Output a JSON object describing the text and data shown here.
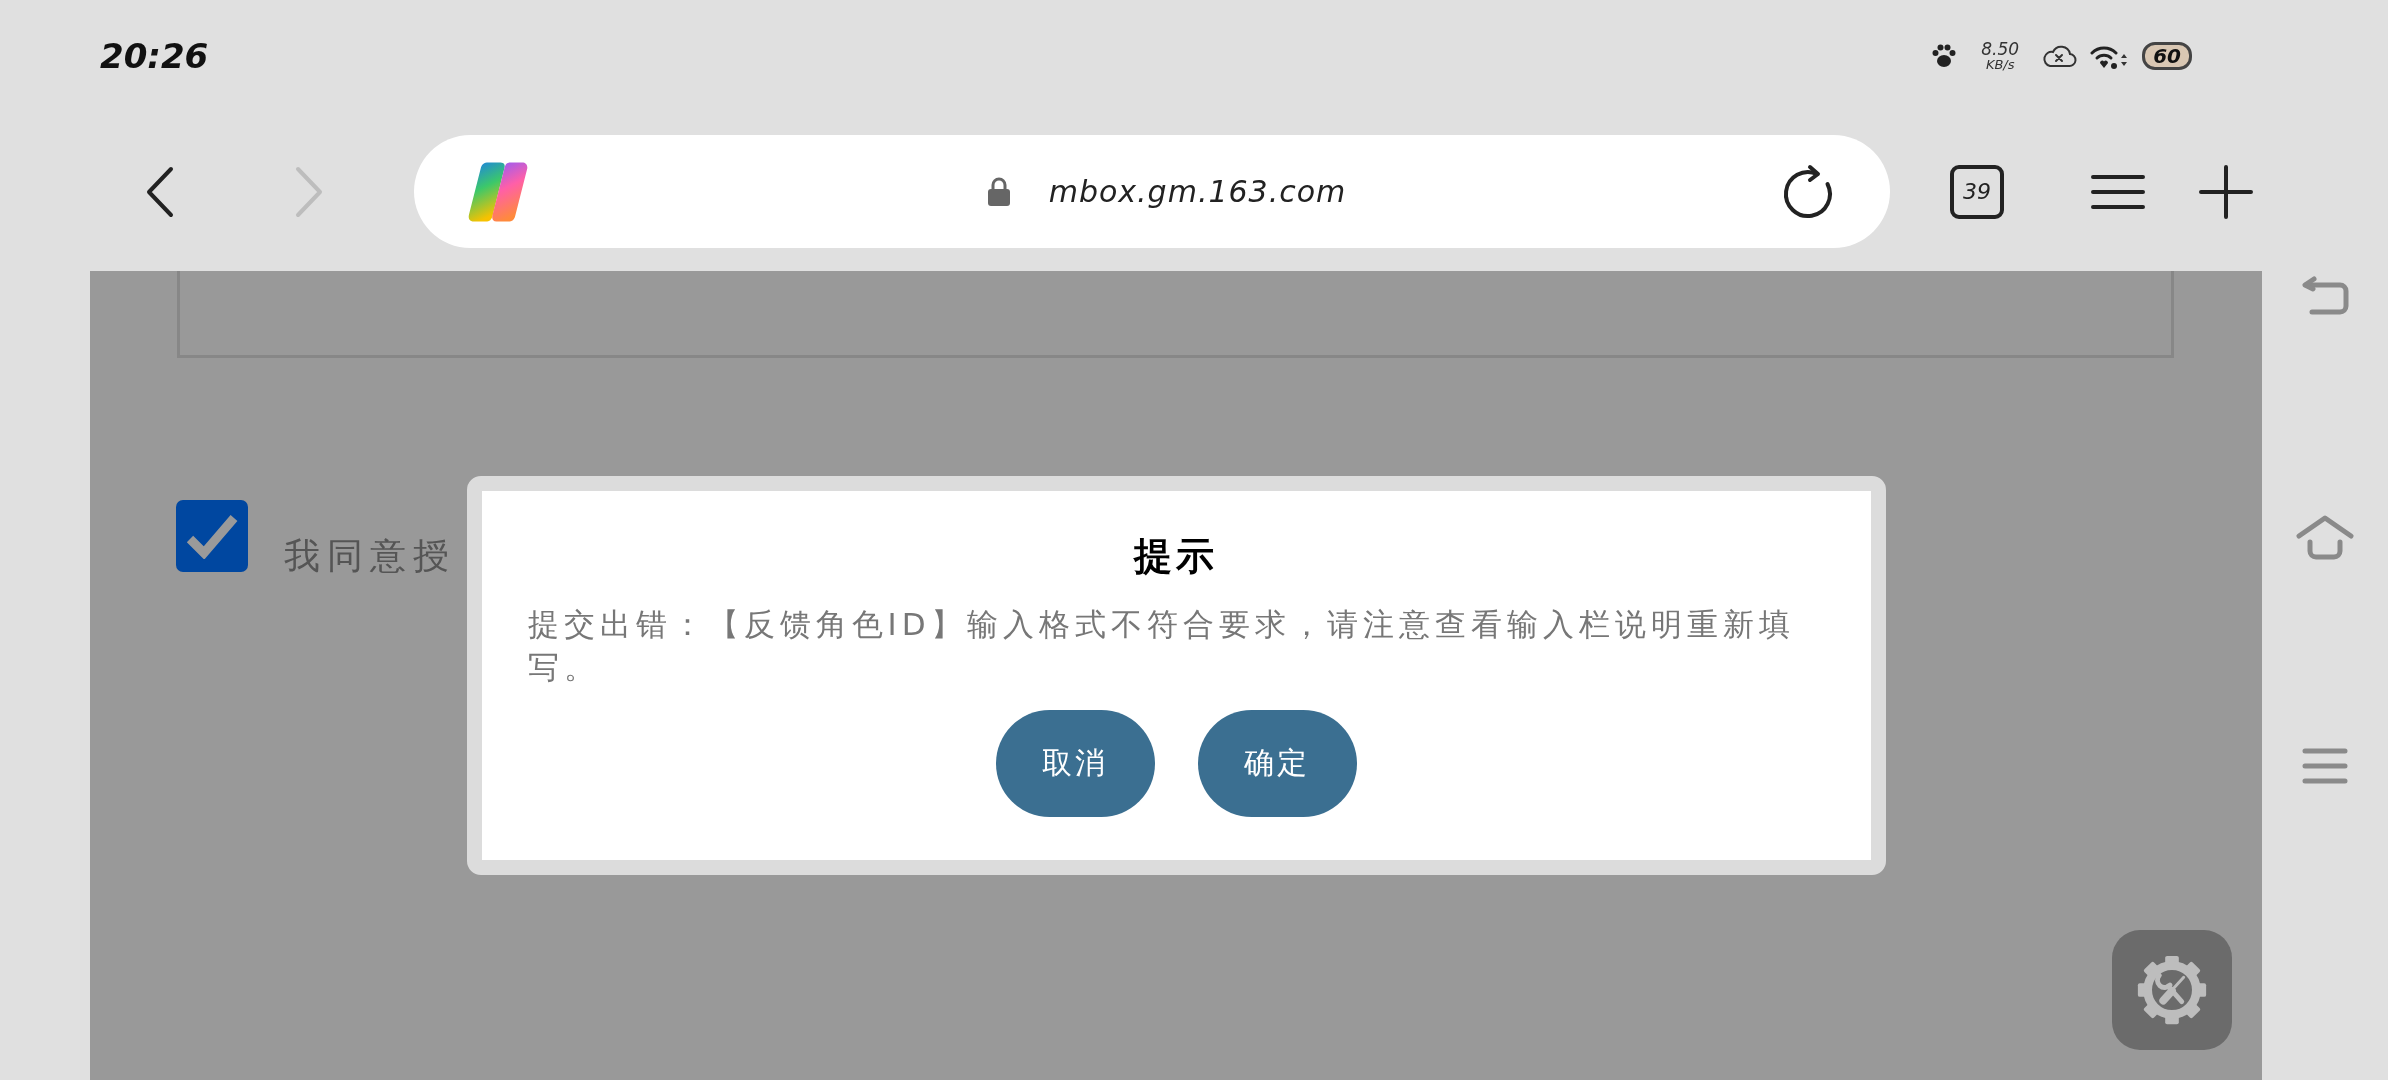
{
  "status_bar": {
    "time": "20:26",
    "network_speed": "8.50",
    "network_speed_unit": "KB/s",
    "battery": "60"
  },
  "browser_toolbar": {
    "navigation": [
      {
        "kind": "back",
        "disabled": false
      },
      {
        "kind": "forward",
        "disabled": true
      }
    ],
    "url": "mbox.gm.163.com",
    "tab_count": "39"
  },
  "page": {
    "agreement": {
      "label": "我同意授",
      "checked": true
    }
  },
  "dialog": {
    "title": "提示",
    "message": "提交出错：【反馈角色ID】输入格式不符合要求，请注意查看输入栏说明重新填写。",
    "buttons": [
      {
        "label": "取消"
      },
      {
        "label": "确定"
      }
    ]
  }
}
